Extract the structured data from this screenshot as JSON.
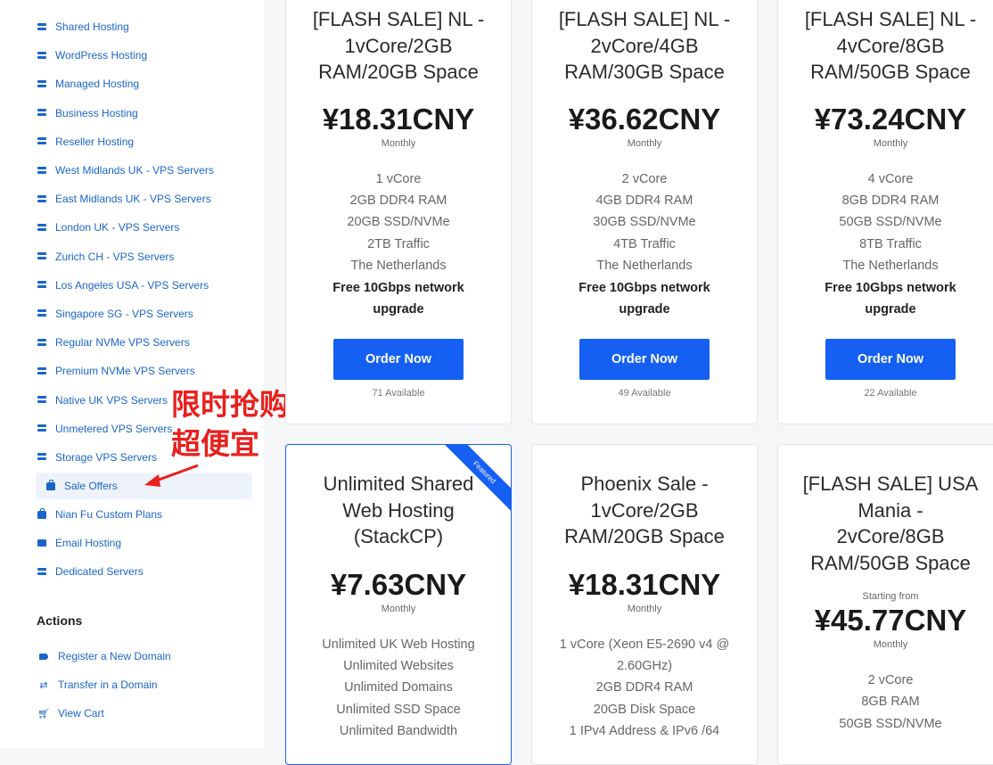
{
  "categories": [
    {
      "label": "Shared Hosting",
      "icon": "server-icon"
    },
    {
      "label": "WordPress Hosting",
      "icon": "server-icon"
    },
    {
      "label": "Managed Hosting",
      "icon": "server-icon"
    },
    {
      "label": "Business Hosting",
      "icon": "server-icon"
    },
    {
      "label": "Reseller Hosting",
      "icon": "server-icon"
    },
    {
      "label": "West Midlands UK - VPS Servers",
      "icon": "server-icon"
    },
    {
      "label": "East Midlands UK - VPS Servers",
      "icon": "server-icon"
    },
    {
      "label": "London UK - VPS Servers",
      "icon": "server-icon"
    },
    {
      "label": "Zurich CH - VPS Servers",
      "icon": "server-icon"
    },
    {
      "label": "Los Angeles USA - VPS Servers",
      "icon": "server-icon"
    },
    {
      "label": "Singapore SG - VPS Servers",
      "icon": "server-icon"
    },
    {
      "label": "Regular NVMe VPS Servers",
      "icon": "server-icon"
    },
    {
      "label": "Premium NVMe VPS Servers",
      "icon": "server-icon"
    },
    {
      "label": "Native UK VPS Servers",
      "icon": "server-icon"
    },
    {
      "label": "Unmetered VPS Servers",
      "icon": "server-icon"
    },
    {
      "label": "Storage VPS Servers",
      "icon": "server-icon"
    },
    {
      "label": "Sale Offers",
      "icon": "shopping-bag-icon",
      "active": true
    },
    {
      "label": "Nian Fu Custom Plans",
      "icon": "shopping-bag-icon"
    },
    {
      "label": "Email Hosting",
      "icon": "envelope-icon"
    },
    {
      "label": "Dedicated Servers",
      "icon": "server-icon"
    }
  ],
  "actions": {
    "title": "Actions",
    "items": [
      {
        "label": "Register a New Domain",
        "icon": "tag-icon"
      },
      {
        "label": "Transfer in a Domain",
        "icon": "transfer-icon"
      },
      {
        "label": "View Cart",
        "icon": "cart-icon"
      }
    ]
  },
  "annotation": {
    "line1": "限时抢购区",
    "line2": "超便宜",
    "color": "#e8201d"
  },
  "products": [
    {
      "title_lines": [
        "[FLASH SALE] NL -",
        "1vCore/2GB",
        "RAM/20GB Space"
      ],
      "price": "¥18.31CNY",
      "cycle": "Monthly",
      "features": [
        "1 vCore",
        "2GB DDR4 RAM",
        "20GB SSD/NVMe",
        "2TB Traffic",
        "The Netherlands"
      ],
      "bold_features": [
        "Free 10Gbps network",
        "upgrade"
      ],
      "button": "Order Now",
      "available": "71 Available"
    },
    {
      "title_lines": [
        "[FLASH SALE] NL -",
        "2vCore/4GB",
        "RAM/30GB Space"
      ],
      "price": "¥36.62CNY",
      "cycle": "Monthly",
      "features": [
        "2 vCore",
        "4GB DDR4 RAM",
        "30GB SSD/NVMe",
        "4TB Traffic",
        "The Netherlands"
      ],
      "bold_features": [
        "Free 10Gbps network",
        "upgrade"
      ],
      "button": "Order Now",
      "available": "49 Available"
    },
    {
      "title_lines": [
        "[FLASH SALE] NL -",
        "4vCore/8GB",
        "RAM/50GB Space"
      ],
      "price": "¥73.24CNY",
      "cycle": "Monthly",
      "features": [
        "4 vCore",
        "8GB DDR4 RAM",
        "50GB SSD/NVMe",
        "8TB Traffic",
        "The Netherlands"
      ],
      "bold_features": [
        "Free 10Gbps network",
        "upgrade"
      ],
      "button": "Order Now",
      "available": "22 Available"
    },
    {
      "ribbon": "Featured",
      "title_lines": [
        "Unlimited Shared",
        "Web Hosting",
        "(StackCP)"
      ],
      "price": "¥7.63CNY",
      "cycle": "Monthly",
      "features": [
        "Unlimited UK Web Hosting",
        "Unlimited Websites",
        "Unlimited Domains",
        "Unlimited SSD Space",
        "Unlimited Bandwidth"
      ]
    },
    {
      "title_lines": [
        "Phoenix Sale -",
        "1vCore/2GB",
        "RAM/20GB Space"
      ],
      "price": "¥18.31CNY",
      "cycle": "Monthly",
      "features": [
        "1 vCore (Xeon E5-2690 v4 @",
        "2.60GHz)",
        "2GB DDR4 RAM",
        "20GB Disk Space",
        "1 IPv4 Address & IPv6 /64"
      ]
    },
    {
      "title_lines": [
        "[FLASH SALE] USA",
        "Mania -",
        "2vCore/8GB",
        "RAM/50GB Space"
      ],
      "starting": "Starting from",
      "price": "¥45.77CNY",
      "cycle": "Monthly",
      "features": [
        "2 vCore",
        "8GB RAM",
        "50GB SSD/NVMe"
      ]
    }
  ],
  "colors": {
    "accent": "#1560f2",
    "link": "#1b65c9",
    "annotation": "#e8201d"
  }
}
